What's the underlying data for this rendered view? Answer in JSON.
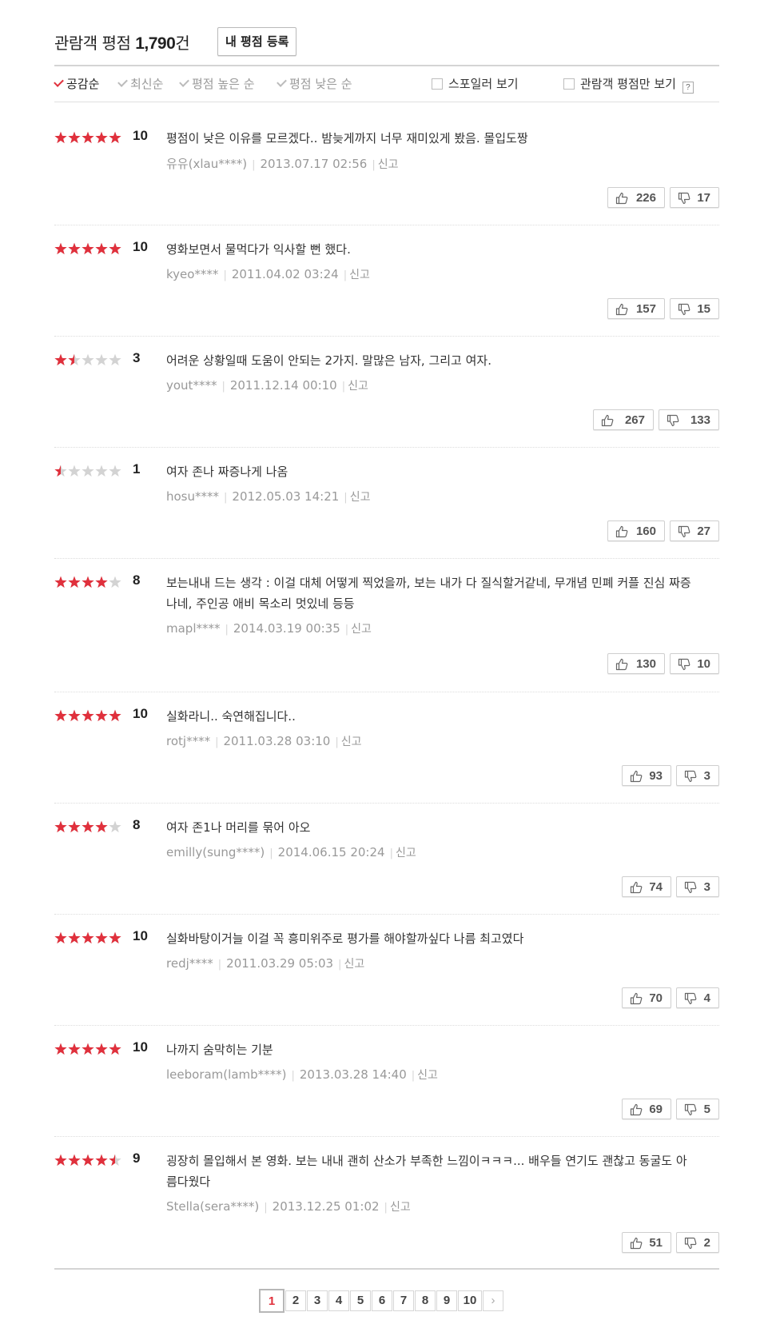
{
  "header": {
    "title": "관람객 평점",
    "count": "1,790",
    "count_unit": "건",
    "register_button": "내 평점 등록"
  },
  "sort_tabs": [
    "공감순",
    "최신순",
    "평점 높은 순",
    "평점 낮은 순"
  ],
  "active_sort_index": 0,
  "filters": {
    "spoiler": "스포일러 보기",
    "audience_only": "관람객 평점만 보기",
    "help": "?"
  },
  "report_label": "신고",
  "star_colors": {
    "on": "#e0303c",
    "off": "#d3d3d3"
  },
  "reviews": [
    {
      "score": "10",
      "rating": 10,
      "text": "평점이 낮은 이유를 모르겠다.. 밤늦게까지 너무 재미있게 봤음. 몰입도짱",
      "user": "유유(xlau****)",
      "date": "2013.07.17 02:56",
      "likes": "226",
      "dislikes": "17"
    },
    {
      "score": "10",
      "rating": 10,
      "text": "영화보면서 물먹다가 익사할 뻔 했다.",
      "user": "kyeo****",
      "date": "2011.04.02 03:24",
      "likes": "157",
      "dislikes": "15"
    },
    {
      "score": "3",
      "rating": 3,
      "text": "어려운 상황일때 도움이 안되는 2가지. 말많은 남자, 그리고 여자.",
      "user": "yout****",
      "date": "2011.12.14 00:10",
      "likes": "267",
      "dislikes": "133"
    },
    {
      "score": "1",
      "rating": 1,
      "text": "여자 존나 짜증나게 나옴",
      "user": "hosu****",
      "date": "2012.05.03 14:21",
      "likes": "160",
      "dislikes": "27"
    },
    {
      "score": "8",
      "rating": 8,
      "text": "보는내내 드는 생각 : 이걸 대체 어떻게 찍었을까, 보는 내가 다 질식할거같네, 무개념 민폐 커플 진심 짜증나네, 주인공 애비 목소리 멋있네 등등",
      "user": "mapl****",
      "date": "2014.03.19 00:35",
      "likes": "130",
      "dislikes": "10"
    },
    {
      "score": "10",
      "rating": 10,
      "text": "실화라니.. 숙연해집니다..",
      "user": "rotj****",
      "date": "2011.03.28 03:10",
      "likes": "93",
      "dislikes": "3"
    },
    {
      "score": "8",
      "rating": 8,
      "text": "여자 존1나 머리를 묶어 아오",
      "user": "emilly(sung****)",
      "date": "2014.06.15 20:24",
      "likes": "74",
      "dislikes": "3"
    },
    {
      "score": "10",
      "rating": 10,
      "text": "실화바탕이거늘 이걸 꼭 흥미위주로 평가를 해야할까싶다 나름 최고였다",
      "user": "redj****",
      "date": "2011.03.29 05:03",
      "likes": "70",
      "dislikes": "4"
    },
    {
      "score": "10",
      "rating": 10,
      "text": "나까지 숨막히는 기분",
      "user": "leeboram(lamb****)",
      "date": "2013.03.28 14:40",
      "likes": "69",
      "dislikes": "5"
    },
    {
      "score": "9",
      "rating": 9,
      "text": "굉장히 몰입해서 본 영화. 보는 내내 괜히 산소가 부족한 느낌이ㅋㅋㅋ... 배우들 연기도 괜찮고 동굴도 아름다웠다",
      "user": "Stella(sera****)",
      "date": "2013.12.25 01:02",
      "likes": "51",
      "dislikes": "2"
    }
  ],
  "pagination": {
    "pages": [
      "1",
      "2",
      "3",
      "4",
      "5",
      "6",
      "7",
      "8",
      "9",
      "10"
    ],
    "current": "1",
    "next": "›"
  }
}
